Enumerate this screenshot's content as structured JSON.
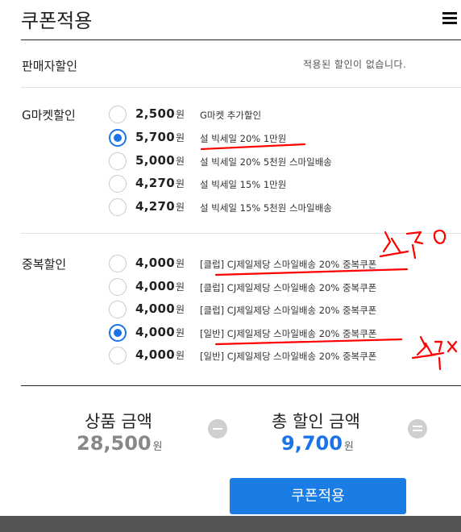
{
  "header": {
    "title": "쿠폰적용",
    "menu_icon": "hamburger-menu-icon"
  },
  "seller_discount": {
    "label": "판매자할인",
    "status": "적용된 할인이 없습니다."
  },
  "gmarket_discount": {
    "label": "G마켓할인",
    "options": [
      {
        "amount": "2,500",
        "unit": "원",
        "desc": "G마켓 추가할인",
        "selected": false
      },
      {
        "amount": "5,700",
        "unit": "원",
        "desc": "설 빅세일 20% 1만원",
        "selected": true
      },
      {
        "amount": "5,000",
        "unit": "원",
        "desc": "설 빅세일 20% 5천원 스마일배송",
        "selected": false
      },
      {
        "amount": "4,270",
        "unit": "원",
        "desc": "설 빅세일 15% 1만원",
        "selected": false
      },
      {
        "amount": "4,270",
        "unit": "원",
        "desc": "설 빅세일 15% 5천원 스마일배송",
        "selected": false
      }
    ]
  },
  "duplicate_discount": {
    "label": "중복할인",
    "options": [
      {
        "amount": "4,000",
        "unit": "원",
        "desc": "[클럽] CJ제일제당 스마일배송 20% 중복쿠폰",
        "selected": false
      },
      {
        "amount": "4,000",
        "unit": "원",
        "desc": "[클럽] CJ제일제당 스마일배송 20% 중복쿠폰",
        "selected": false
      },
      {
        "amount": "4,000",
        "unit": "원",
        "desc": "[클럽] CJ제일제당 스마일배송 20% 중복쿠폰",
        "selected": false
      },
      {
        "amount": "4,000",
        "unit": "원",
        "desc": "[일반] CJ제일제당 스마일배송 20% 중복쿠폰",
        "selected": true
      },
      {
        "amount": "4,000",
        "unit": "원",
        "desc": "[일반] CJ제일제당 스마일배송 20% 중복쿠폰",
        "selected": false
      }
    ]
  },
  "summary": {
    "product_label": "상품 금액",
    "product_value": "28,500",
    "total_discount_label": "총 할인 금액",
    "total_discount_value": "9,700",
    "unit": "원",
    "minus_icon": "minus-circle-icon",
    "equals_icon": "equals-circle-icon"
  },
  "apply_button": {
    "label": "쿠폰적용"
  },
  "colors": {
    "accent": "#1a7de6",
    "discount_value": "#1a73e8",
    "product_value": "#888888",
    "annotation": "#ff0000"
  }
}
